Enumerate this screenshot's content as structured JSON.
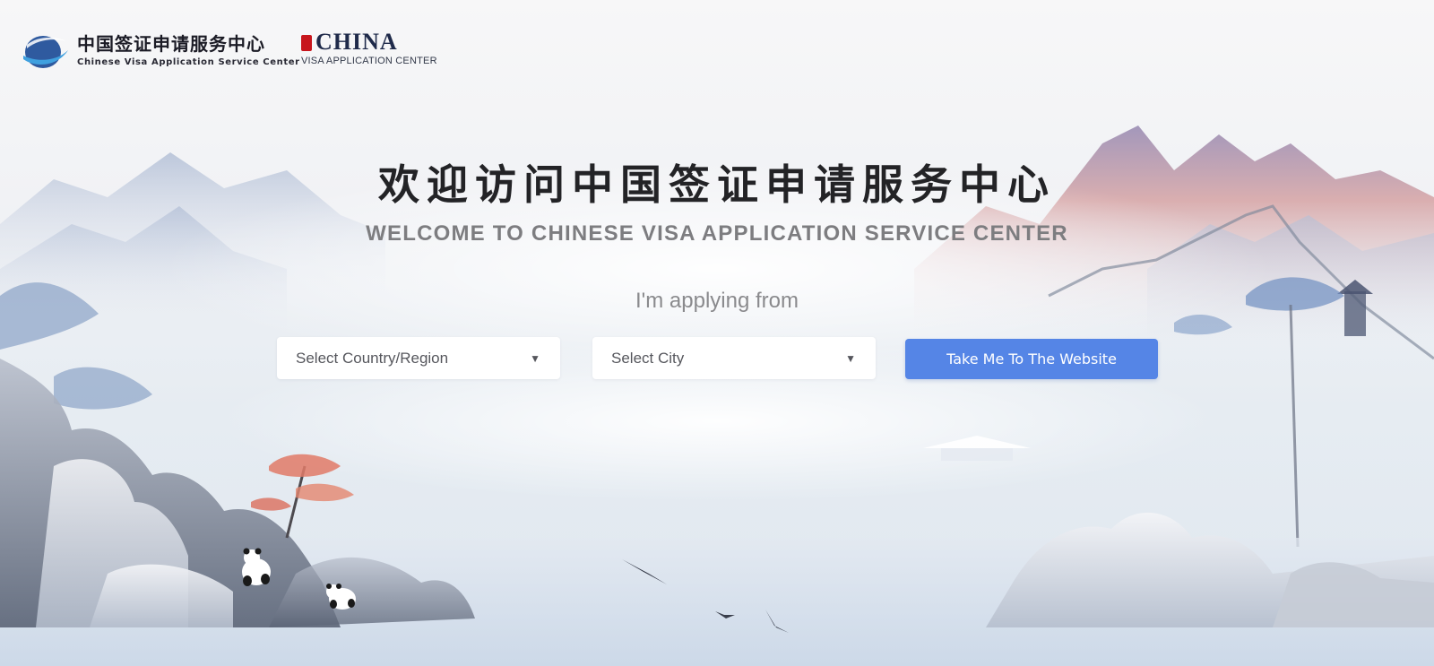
{
  "header": {
    "cvasc_logo": {
      "cn": "中国签证申请服务中心",
      "en": "Chinese Visa Application Service Center"
    },
    "china_logo": {
      "word": "CHINA",
      "sub": "VISA APPLICATION CENTER"
    }
  },
  "hero": {
    "title_cn": "欢迎访问中国签证申请服务中心",
    "title_en": "WELCOME TO CHINESE VISA APPLICATION SERVICE CENTER",
    "prompt": "I'm applying from"
  },
  "form": {
    "country_select": {
      "label": "Select Country/Region",
      "icon": "caret-down-icon"
    },
    "city_select": {
      "label": "Select City",
      "icon": "caret-down-icon"
    },
    "submit_label": "Take Me To The Website"
  },
  "colors": {
    "button": "#5585e6",
    "title": "#232326",
    "subtitle": "#7d7d80"
  }
}
